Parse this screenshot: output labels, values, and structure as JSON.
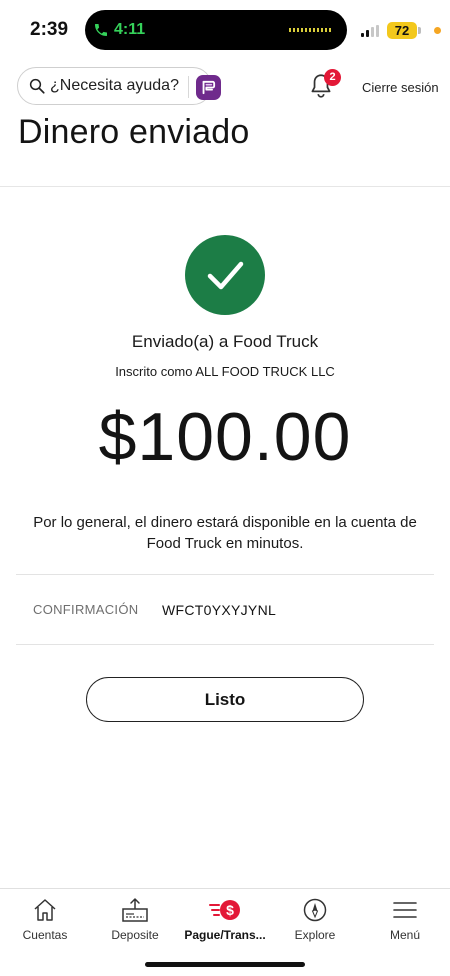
{
  "status_bar": {
    "time": "2:39",
    "call_time": "4:11",
    "battery": "72"
  },
  "header": {
    "help_search_label": "¿Necesita ayuda?",
    "notification_count": "2",
    "sign_out": "Cierre sesión"
  },
  "page": {
    "title": "Dinero enviado"
  },
  "confirmation": {
    "sent_to": "Enviado(a) a Food Truck",
    "registered_as": "Inscrito como ALL FOOD TRUCK LLC",
    "amount": "$100.00",
    "availability_note": "Por lo general, el dinero estará disponible en la cuenta de Food Truck en minutos.",
    "confirmation_label": "CONFIRMACIÓN",
    "confirmation_code": "WFCT0YXYJYNL",
    "done_button": "Listo"
  },
  "bottom_nav": {
    "items": [
      {
        "label": "Cuentas",
        "icon": "home-icon"
      },
      {
        "label": "Deposite",
        "icon": "deposit-icon"
      },
      {
        "label": "Pague/Trans...",
        "icon": "pay-transfer-icon"
      },
      {
        "label": "Explore",
        "icon": "compass-icon"
      },
      {
        "label": "Menú",
        "icon": "menu-icon"
      }
    ],
    "active_index": 2
  },
  "colors": {
    "success_green": "#1c7d46",
    "badge_red": "#e31837",
    "erica_purple": "#6f2a8c",
    "call_green": "#35d15a",
    "battery_yellow": "#f3c81c"
  }
}
